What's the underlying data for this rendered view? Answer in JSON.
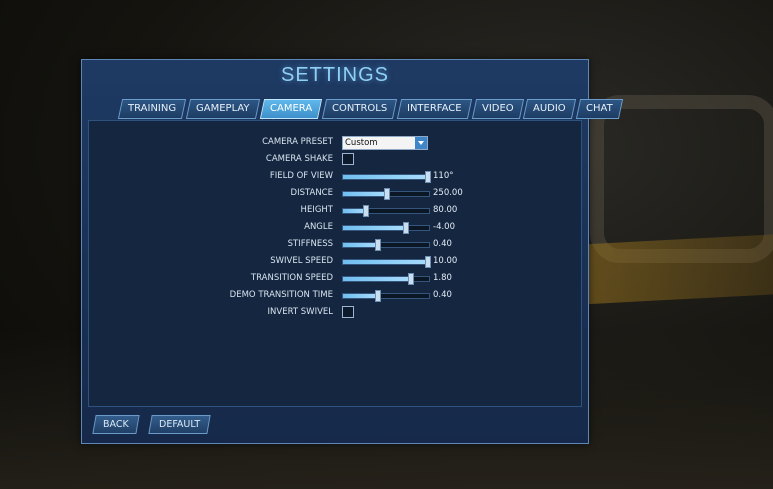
{
  "title": "SETTINGS",
  "tabs": [
    {
      "label": "TRAINING",
      "active": false
    },
    {
      "label": "GAMEPLAY",
      "active": false
    },
    {
      "label": "CAMERA",
      "active": true
    },
    {
      "label": "CONTROLS",
      "active": false
    },
    {
      "label": "INTERFACE",
      "active": false
    },
    {
      "label": "VIDEO",
      "active": false
    },
    {
      "label": "AUDIO",
      "active": false
    },
    {
      "label": "CHAT",
      "active": false
    }
  ],
  "settings": {
    "camera_preset": {
      "label": "CAMERA PRESET",
      "value": "Custom"
    },
    "camera_shake": {
      "label": "CAMERA SHAKE",
      "checked": false
    },
    "field_of_view": {
      "label": "FIELD OF VIEW",
      "value": "110°",
      "level": 1.0
    },
    "distance": {
      "label": "DISTANCE",
      "value": "250.00",
      "level": 0.5
    },
    "height": {
      "label": "HEIGHT",
      "value": "80.00",
      "level": 0.25
    },
    "angle": {
      "label": "ANGLE",
      "value": "-4.00",
      "level": 0.72
    },
    "stiffness": {
      "label": "STIFFNESS",
      "value": "0.40",
      "level": 0.4
    },
    "swivel_speed": {
      "label": "SWIVEL SPEED",
      "value": "10.00",
      "level": 1.0
    },
    "transition_speed": {
      "label": "TRANSITION SPEED",
      "value": "1.80",
      "level": 0.78
    },
    "demo_transition_time": {
      "label": "DEMO TRANSITION TIME",
      "value": "0.40",
      "level": 0.4
    },
    "invert_swivel": {
      "label": "INVERT SWIVEL",
      "checked": false
    }
  },
  "buttons": {
    "back": "BACK",
    "default": "DEFAULT"
  },
  "colors": {
    "accent": "#5fb8ec",
    "panel": "#1e3a63",
    "title": "#8fd0f5"
  }
}
